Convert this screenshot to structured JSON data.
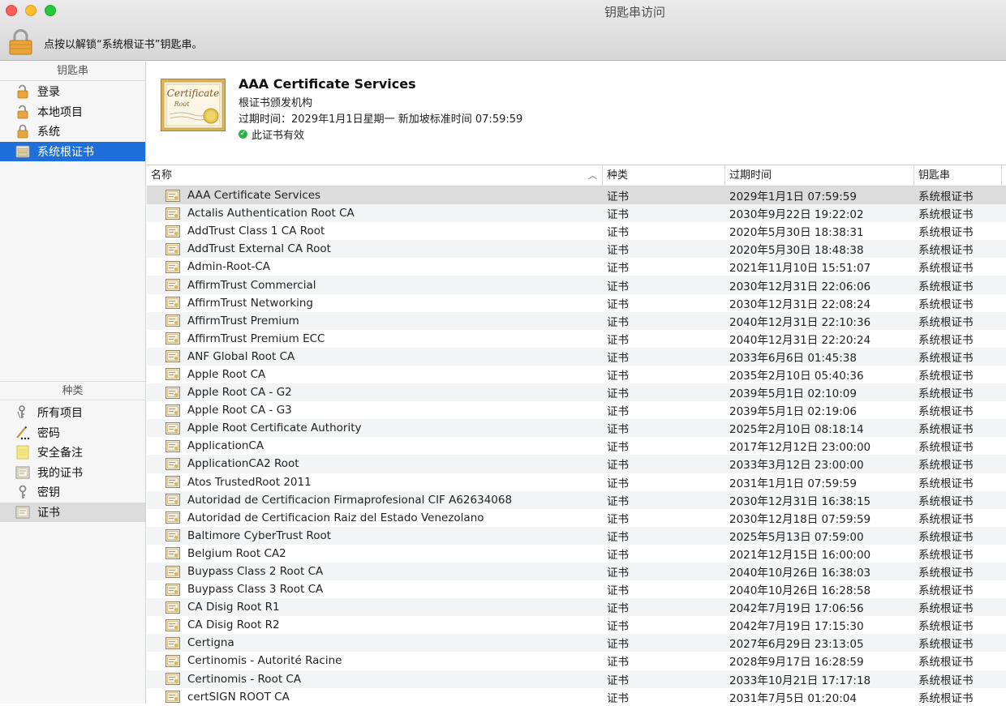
{
  "window": {
    "title": "钥匙串访问"
  },
  "toolbar": {
    "lock_message": "点按以解锁“系统根证书”钥匙串。"
  },
  "sidebar": {
    "keychains_header": "钥匙串",
    "keychains": [
      {
        "label": "登录",
        "icon": "unlocked-padlock-icon"
      },
      {
        "label": "本地项目",
        "icon": "unlocked-padlock-icon"
      },
      {
        "label": "系统",
        "icon": "padlock-icon"
      },
      {
        "label": "系统根证书",
        "icon": "cabinet-icon",
        "selected": true
      }
    ],
    "kinds_header": "种类",
    "kinds": [
      {
        "label": "所有项目",
        "icon": "all-items-icon"
      },
      {
        "label": "密码",
        "icon": "password-icon"
      },
      {
        "label": "安全备注",
        "icon": "note-icon"
      },
      {
        "label": "我的证书",
        "icon": "my-certificate-icon"
      },
      {
        "label": "密钥",
        "icon": "key-icon"
      },
      {
        "label": "证书",
        "icon": "certificate-icon",
        "selected": true
      }
    ]
  },
  "detail": {
    "cert_image_text": "Certificate Root",
    "title": "AAA Certificate Services",
    "kind": "根证书颁发机构",
    "expiry": "过期时间：2029年1月1日星期一 新加坡标准时间 07:59:59",
    "validity": "此证书有效"
  },
  "table": {
    "columns": {
      "name": "名称",
      "kind": "种类",
      "expires": "过期时间",
      "keychain": "钥匙串"
    },
    "rows": [
      {
        "name": "AAA Certificate Services",
        "kind": "证书",
        "expires": "2029年1月1日 07:59:59",
        "keychain": "系统根证书"
      },
      {
        "name": "Actalis Authentication Root CA",
        "kind": "证书",
        "expires": "2030年9月22日 19:22:02",
        "keychain": "系统根证书"
      },
      {
        "name": "AddTrust Class 1 CA Root",
        "kind": "证书",
        "expires": "2020年5月30日 18:38:31",
        "keychain": "系统根证书"
      },
      {
        "name": "AddTrust External CA Root",
        "kind": "证书",
        "expires": "2020年5月30日 18:48:38",
        "keychain": "系统根证书"
      },
      {
        "name": "Admin-Root-CA",
        "kind": "证书",
        "expires": "2021年11月10日 15:51:07",
        "keychain": "系统根证书"
      },
      {
        "name": "AffirmTrust Commercial",
        "kind": "证书",
        "expires": "2030年12月31日 22:06:06",
        "keychain": "系统根证书"
      },
      {
        "name": "AffirmTrust Networking",
        "kind": "证书",
        "expires": "2030年12月31日 22:08:24",
        "keychain": "系统根证书"
      },
      {
        "name": "AffirmTrust Premium",
        "kind": "证书",
        "expires": "2040年12月31日 22:10:36",
        "keychain": "系统根证书"
      },
      {
        "name": "AffirmTrust Premium ECC",
        "kind": "证书",
        "expires": "2040年12月31日 22:20:24",
        "keychain": "系统根证书"
      },
      {
        "name": "ANF Global Root CA",
        "kind": "证书",
        "expires": "2033年6月6日 01:45:38",
        "keychain": "系统根证书"
      },
      {
        "name": "Apple Root CA",
        "kind": "证书",
        "expires": "2035年2月10日 05:40:36",
        "keychain": "系统根证书"
      },
      {
        "name": "Apple Root CA - G2",
        "kind": "证书",
        "expires": "2039年5月1日 02:10:09",
        "keychain": "系统根证书"
      },
      {
        "name": "Apple Root CA - G3",
        "kind": "证书",
        "expires": "2039年5月1日 02:19:06",
        "keychain": "系统根证书"
      },
      {
        "name": "Apple Root Certificate Authority",
        "kind": "证书",
        "expires": "2025年2月10日 08:18:14",
        "keychain": "系统根证书"
      },
      {
        "name": "ApplicationCA",
        "kind": "证书",
        "expires": "2017年12月12日 23:00:00",
        "keychain": "系统根证书"
      },
      {
        "name": "ApplicationCA2 Root",
        "kind": "证书",
        "expires": "2033年3月12日 23:00:00",
        "keychain": "系统根证书"
      },
      {
        "name": "Atos TrustedRoot 2011",
        "kind": "证书",
        "expires": "2031年1月1日 07:59:59",
        "keychain": "系统根证书"
      },
      {
        "name": "Autoridad de Certificacion Firmaprofesional CIF A62634068",
        "kind": "证书",
        "expires": "2030年12月31日 16:38:15",
        "keychain": "系统根证书"
      },
      {
        "name": "Autoridad de Certificacion Raiz del Estado Venezolano",
        "kind": "证书",
        "expires": "2030年12月18日 07:59:59",
        "keychain": "系统根证书"
      },
      {
        "name": "Baltimore CyberTrust Root",
        "kind": "证书",
        "expires": "2025年5月13日 07:59:00",
        "keychain": "系统根证书"
      },
      {
        "name": "Belgium Root CA2",
        "kind": "证书",
        "expires": "2021年12月15日 16:00:00",
        "keychain": "系统根证书"
      },
      {
        "name": "Buypass Class 2 Root CA",
        "kind": "证书",
        "expires": "2040年10月26日 16:38:03",
        "keychain": "系统根证书"
      },
      {
        "name": "Buypass Class 3 Root CA",
        "kind": "证书",
        "expires": "2040年10月26日 16:28:58",
        "keychain": "系统根证书"
      },
      {
        "name": "CA Disig Root R1",
        "kind": "证书",
        "expires": "2042年7月19日 17:06:56",
        "keychain": "系统根证书"
      },
      {
        "name": "CA Disig Root R2",
        "kind": "证书",
        "expires": "2042年7月19日 17:15:30",
        "keychain": "系统根证书"
      },
      {
        "name": "Certigna",
        "kind": "证书",
        "expires": "2027年6月29日 23:13:05",
        "keychain": "系统根证书"
      },
      {
        "name": "Certinomis - Autorité Racine",
        "kind": "证书",
        "expires": "2028年9月17日 16:28:59",
        "keychain": "系统根证书"
      },
      {
        "name": "Certinomis - Root CA",
        "kind": "证书",
        "expires": "2033年10月21日 17:17:18",
        "keychain": "系统根证书"
      },
      {
        "name": "certSIGN ROOT CA",
        "kind": "证书",
        "expires": "2031年7月5日 01:20:04",
        "keychain": "系统根证书"
      }
    ]
  }
}
